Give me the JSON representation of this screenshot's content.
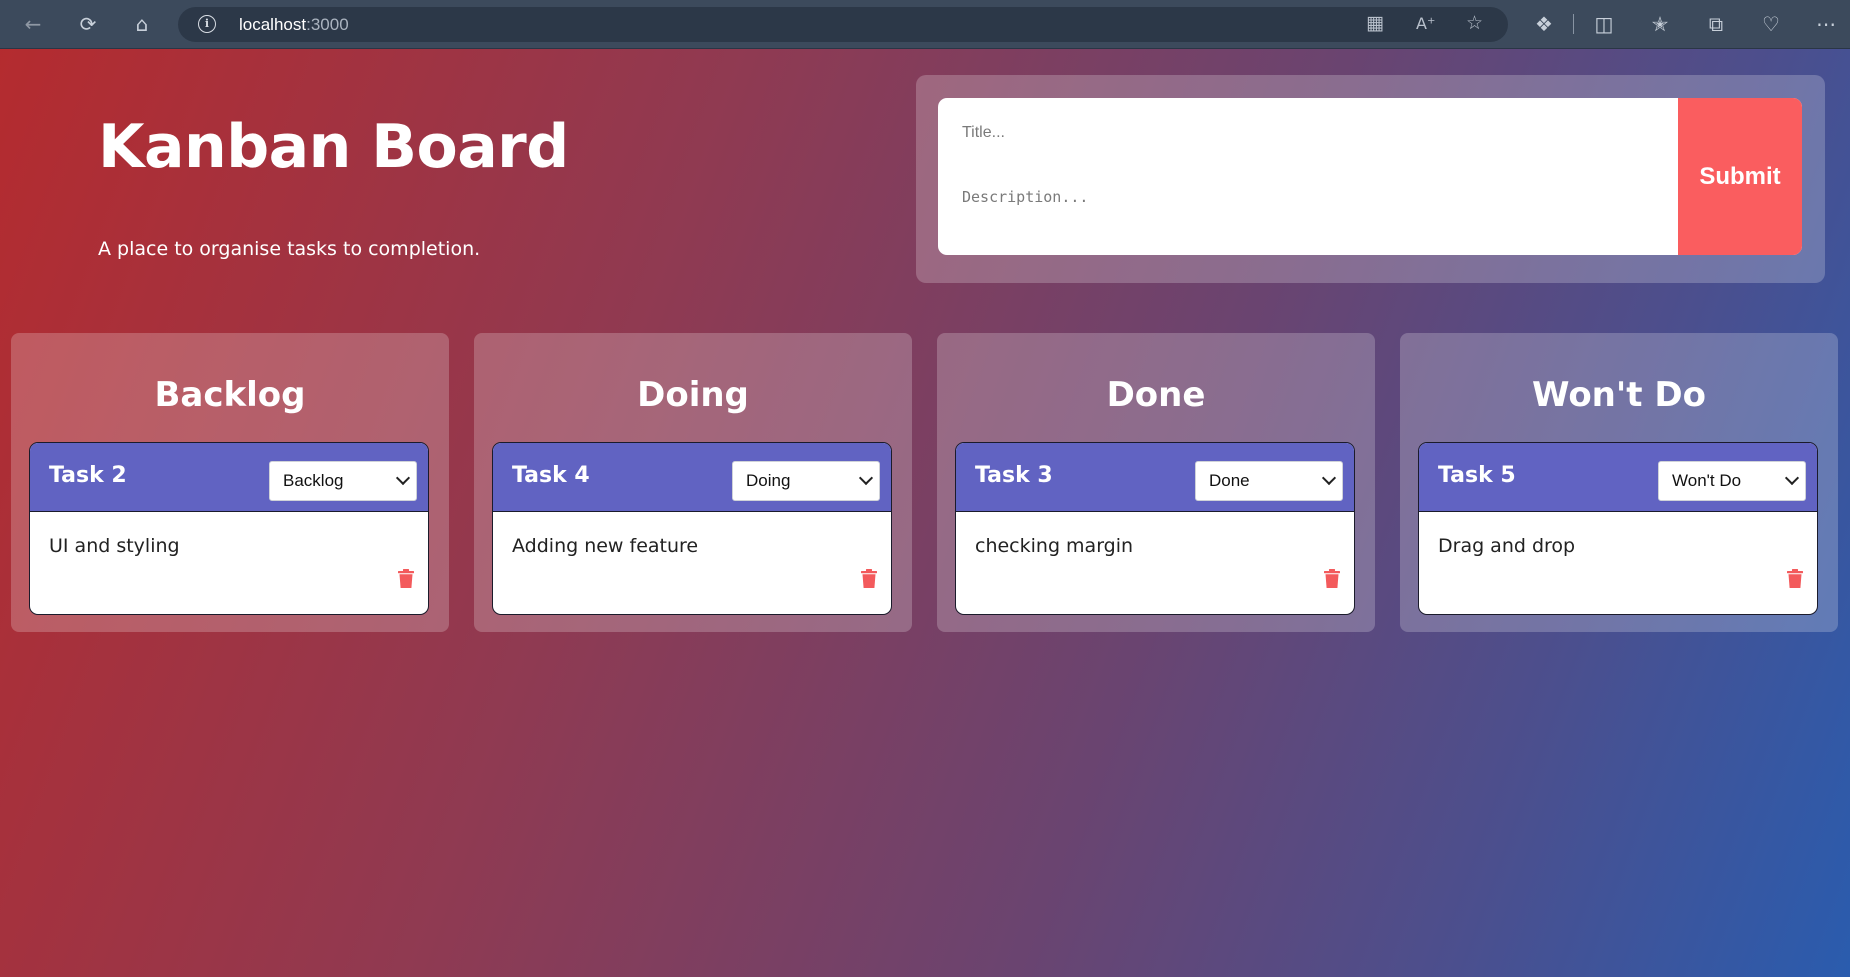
{
  "browser": {
    "url_host": "localhost",
    "url_port": ":3000"
  },
  "header": {
    "title": "Kanban Board",
    "subtitle": "A place to organise tasks to completion."
  },
  "form": {
    "title_placeholder": "Title...",
    "description_placeholder": "Description...",
    "submit_label": "Submit"
  },
  "columns": [
    {
      "title": "Backlog",
      "task": {
        "title": "Task 2",
        "status": "Backlog",
        "description": "UI and styling"
      }
    },
    {
      "title": "Doing",
      "task": {
        "title": "Task 4",
        "status": "Doing",
        "description": "Adding new feature"
      }
    },
    {
      "title": "Done",
      "task": {
        "title": "Task 3",
        "status": "Done",
        "description": "checking margin"
      }
    },
    {
      "title": "Won't Do",
      "task": {
        "title": "Task 5",
        "status": "Won't Do",
        "description": "Drag and drop"
      }
    }
  ],
  "colors": {
    "accent": "#fa5d5f",
    "card_header": "#6163c2",
    "gradient_start": "#b52b2e",
    "gradient_end": "#2a5cae"
  }
}
